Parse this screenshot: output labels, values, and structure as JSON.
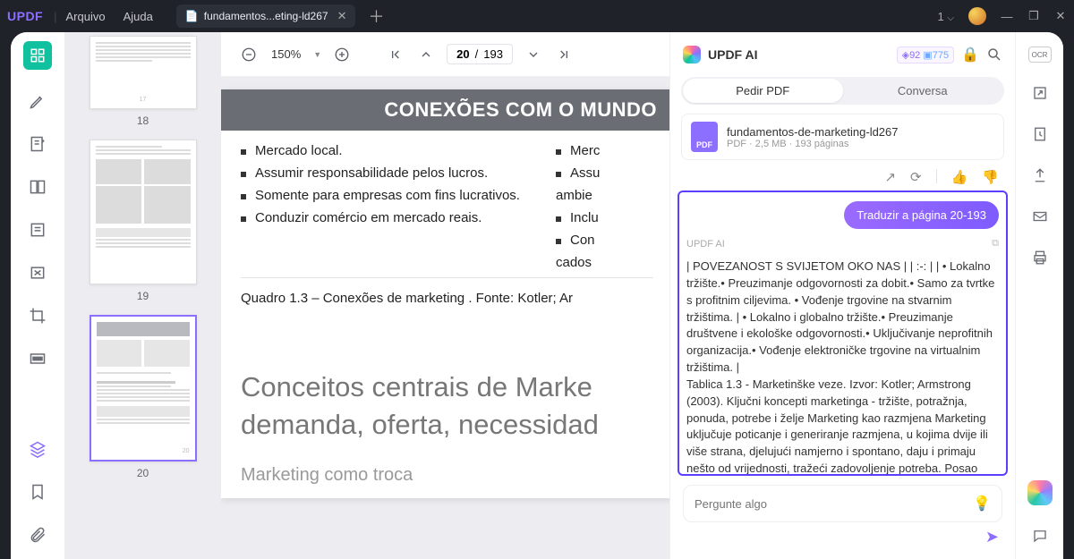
{
  "titlebar": {
    "logo": "UPDF",
    "menu": {
      "file": "Arquivo",
      "help": "Ajuda"
    },
    "tab": {
      "title": "fundamentos...eting-ld267"
    },
    "count": "1"
  },
  "toolbar": {
    "zoom": "150%",
    "page_current": "20",
    "page_total": "193"
  },
  "thumbs": [
    {
      "num": "18"
    },
    {
      "num": "19"
    },
    {
      "num": "20"
    }
  ],
  "doc": {
    "header": "CONEXÕES COM O MUNDO",
    "rows": [
      {
        "l": "Mercado local.",
        "r": "Merc"
      },
      {
        "l": "Assumir responsabilidade pelos lucros.",
        "r": "Assu"
      },
      {
        "l": "Somente para empresas com fins lucrativos.",
        "r": "ambie"
      },
      {
        "l": "Conduzir comércio em mercado reais.",
        "r": "Inclu"
      }
    ],
    "extra1": "Con",
    "extra2": "cados",
    "caption": "Quadro 1.3 – Conexões de marketing . Fonte: Kotler; Ar",
    "big": "Conceitos centrais de Marke demanda, oferta, necessidad",
    "sub": "Marketing como troca"
  },
  "ai": {
    "title": "UPDF AI",
    "badge1": "92",
    "badge2": "775",
    "tabs": {
      "askpdf": "Pedir PDF",
      "chat": "Conversa"
    },
    "file": {
      "name": "fundamentos-de-marketing-ld267",
      "meta": "PDF · 2,5 MB · 193 páginas",
      "icon": "PDF"
    },
    "user_msg": "Traduzir a página 20-193",
    "label": "UPDF AI",
    "response": "| POVEZANOST S SVIJETOM OKO NAS | | :-: | | • Lokalno tržište.• Preuzimanje odgovornosti za dobit.• Samo za tvrtke s profitnim ciljevima. • Vođenje trgovine na stvarnim tržištima. | • Lokalno i globalno tržište.• Preuzimanje društvene i ekološke odgovornosti.• Uključivanje neprofitnih organizacija.• Vođenje elektroničke trgovine na virtualnim tržištima. |\nTablica 1.3 - Marketinške veze. Izvor: Kotler; Armstrong (2003). Ključni koncepti marketinga - tržište, potražnja, ponuda, potrebe i želje Marketing kao razmjena Marketing uključuje poticanje i generiranje razmjena, u kojima dvije ili više strana, djelujući namjerno i spontano, daju i primaju nešto od vrijednosti, tražeći zadovoljenje potreba. Posao marketinškog stru",
    "placeholder": "Pergunte algo"
  }
}
